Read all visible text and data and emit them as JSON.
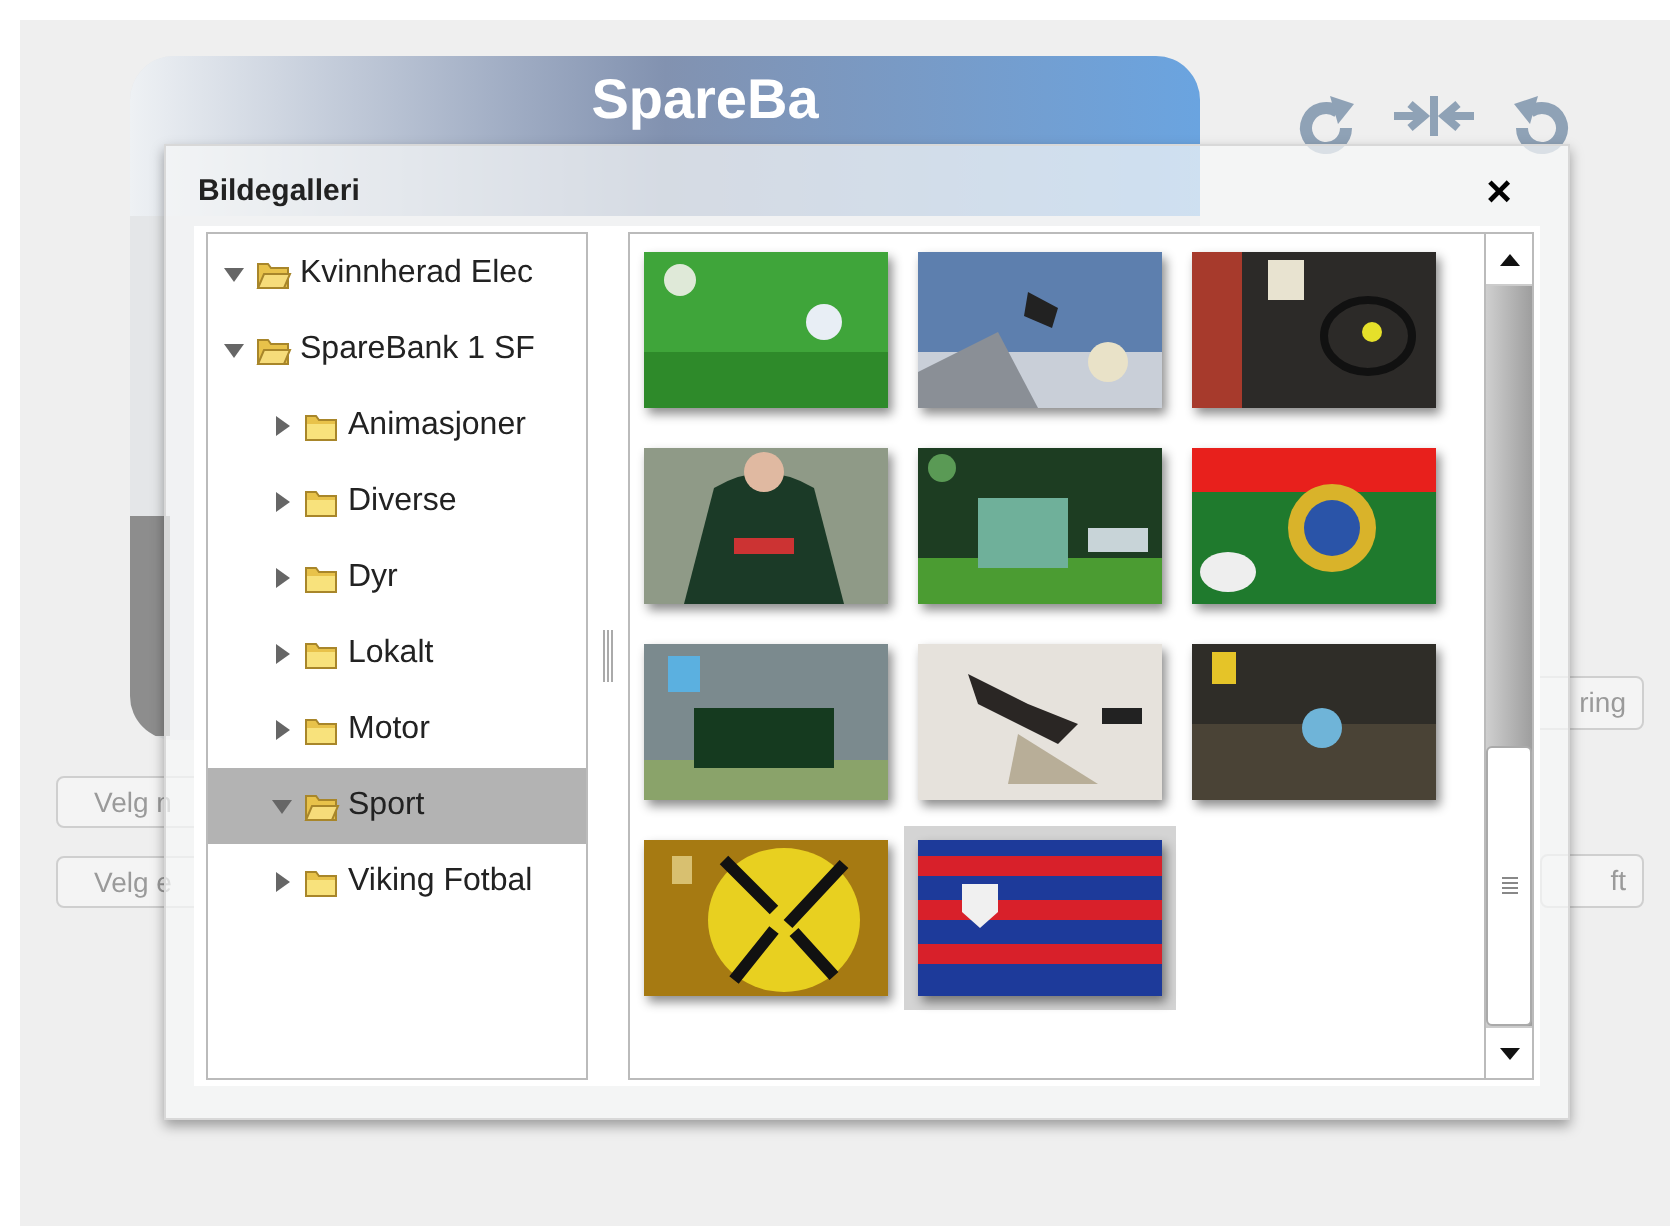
{
  "background": {
    "banner_text": "SpareBa",
    "buttons_left": [
      "Velg n",
      "Velg e"
    ],
    "buttons_right": [
      "ring",
      "ft"
    ]
  },
  "dialog": {
    "title": "Bildegalleri",
    "close": "×"
  },
  "tree": [
    {
      "label": "Kvinnherad Elec",
      "expanded": true,
      "selected": false
    },
    {
      "label": "SpareBank 1 SF",
      "expanded": true,
      "selected": false,
      "children": [
        {
          "label": "Animasjoner",
          "expanded": false,
          "selected": false
        },
        {
          "label": "Diverse",
          "expanded": false,
          "selected": false
        },
        {
          "label": "Dyr",
          "expanded": false,
          "selected": false
        },
        {
          "label": "Lokalt",
          "expanded": false,
          "selected": false
        },
        {
          "label": "Motor",
          "expanded": false,
          "selected": false
        },
        {
          "label": "Sport",
          "expanded": true,
          "selected": true
        },
        {
          "label": "Viking Fotbal",
          "expanded": false,
          "selected": false
        }
      ]
    }
  ],
  "thumbnails": [
    {
      "selected": false
    },
    {
      "selected": false
    },
    {
      "selected": false
    },
    {
      "selected": false
    },
    {
      "selected": false
    },
    {
      "selected": false
    },
    {
      "selected": false
    },
    {
      "selected": false
    },
    {
      "selected": false
    },
    {
      "selected": false
    },
    {
      "selected": true
    }
  ]
}
